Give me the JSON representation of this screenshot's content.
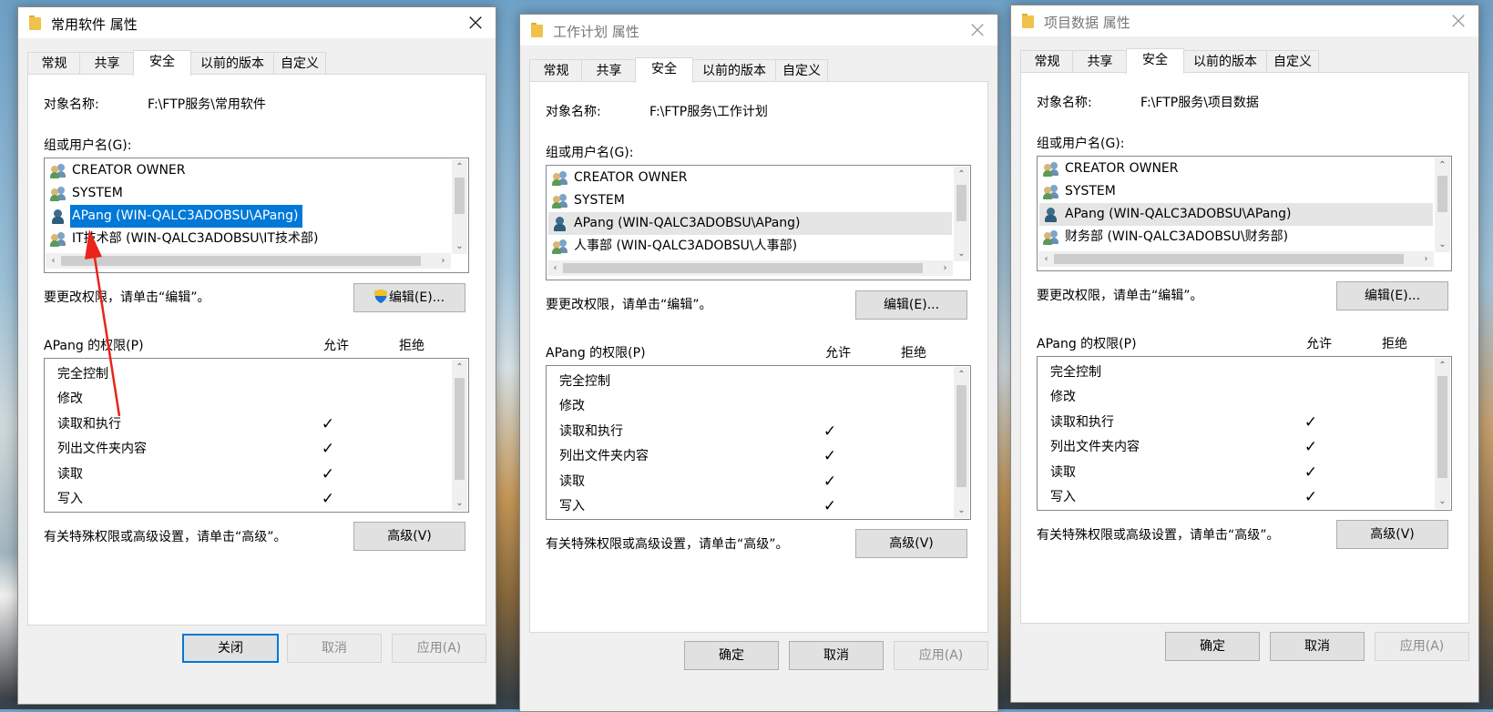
{
  "common": {
    "tabs": [
      "常规",
      "共享",
      "安全",
      "以前的版本",
      "自定义"
    ],
    "object_name_label": "对象名称:",
    "group_label": "组或用户名(G):",
    "change_hint": "要更改权限，请单击“编辑”。",
    "edit_button": "编辑(E)...",
    "allow_label": "允许",
    "deny_label": "拒绝",
    "advanced_hint": "有关特殊权限或高级设置，请单击“高级”。",
    "advanced_button": "高级(V)",
    "permissions": [
      "完全控制",
      "修改",
      "读取和执行",
      "列出文件夹内容",
      "读取",
      "写入"
    ],
    "allowed": [
      false,
      false,
      true,
      true,
      true,
      true
    ],
    "check_glyph": "✓",
    "icons": {
      "folder": "folder-icon",
      "group": "group-users-icon",
      "user": "user-icon",
      "shield": "uac-shield-icon"
    },
    "colors": {
      "selection_blue": "#0078d7",
      "annotation_red": "#e8241b"
    }
  },
  "dialogs": [
    {
      "title": "常用软件 属性",
      "object_path": "F:\\FTP服务\\常用软件",
      "users": [
        "CREATOR OWNER",
        "SYSTEM",
        "APang (WIN-QALC3ADOBSU\\APang)",
        "IT技术部 (WIN-QALC3ADOBSU\\IT技术部)"
      ],
      "perm_header": "APang 的权限(P)",
      "footer_buttons": [
        "关闭",
        "取消",
        "应用(A)"
      ]
    },
    {
      "title": "工作计划 属性",
      "object_path": "F:\\FTP服务\\工作计划",
      "users": [
        "CREATOR OWNER",
        "SYSTEM",
        "APang (WIN-QALC3ADOBSU\\APang)",
        "人事部 (WIN-QALC3ADOBSU\\人事部)"
      ],
      "perm_header": "APang 的权限(P)",
      "footer_buttons": [
        "确定",
        "取消",
        "应用(A)"
      ]
    },
    {
      "title": "项目数据 属性",
      "object_path": "F:\\FTP服务\\项目数据",
      "users": [
        "CREATOR OWNER",
        "SYSTEM",
        "APang (WIN-QALC3ADOBSU\\APang)",
        "财务部 (WIN-QALC3ADOBSU\\财务部)"
      ],
      "perm_header": "APang 的权限(P)",
      "footer_buttons": [
        "确定",
        "取消",
        "应用(A)"
      ]
    }
  ]
}
